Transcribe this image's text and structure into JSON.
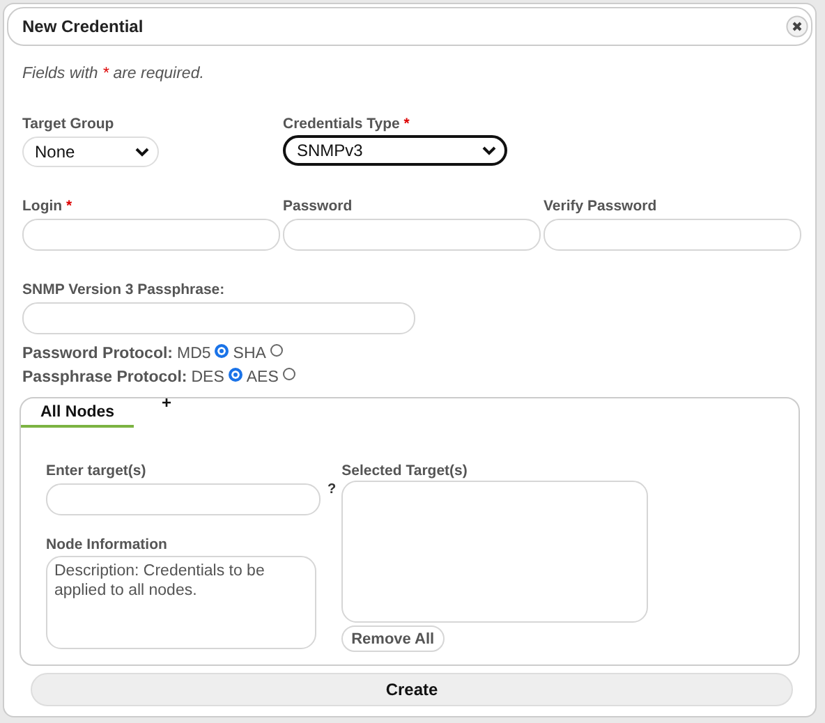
{
  "dialog": {
    "title": "New Credential"
  },
  "required_note": {
    "before": "Fields with",
    "mark": "*",
    "after": "are required."
  },
  "target_group": {
    "label": "Target Group",
    "value": "None"
  },
  "credentials_type": {
    "label": "Credentials Type",
    "required_mark": "*",
    "value": "SNMPv3",
    "focused": true
  },
  "login_fields": [
    {
      "label": "Login",
      "required_mark": "*"
    },
    {
      "label": "Password"
    },
    {
      "label": "Verify Password"
    }
  ],
  "passphrase": {
    "label": "SNMP Version 3 Passphrase:"
  },
  "protocols": [
    {
      "label": "Password Protocol:",
      "options": [
        {
          "label": "MD5",
          "selected": true
        },
        {
          "label": "SHA",
          "selected": false
        }
      ]
    },
    {
      "label": "Passphrase Protocol:",
      "options": [
        {
          "label": "DES",
          "selected": true
        },
        {
          "label": "AES",
          "selected": false
        }
      ]
    }
  ],
  "tabs": [
    {
      "label": "All Nodes",
      "selected": true
    }
  ],
  "add_tab": "+",
  "targets": {
    "label": "Enter target(s)",
    "help": "?"
  },
  "selected_targets": {
    "label": "Selected Target(s)"
  },
  "node_information": {
    "label": "Node Information",
    "value": "Description: Credentials to be applied to all nodes."
  },
  "remove_all": "Remove All",
  "create": "Create"
}
